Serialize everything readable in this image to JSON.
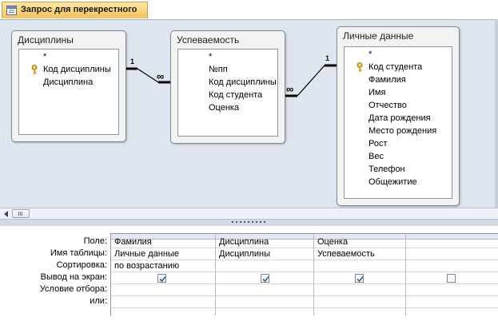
{
  "tab": {
    "title": "Запрос для перекрестного",
    "icon": "query-icon"
  },
  "tables": [
    {
      "id": "discipliny",
      "title": "Дисциплины",
      "fields": [
        {
          "name": "*",
          "key": false
        },
        {
          "name": "Код дисциплины",
          "key": true
        },
        {
          "name": "Дисциплина",
          "key": false
        }
      ]
    },
    {
      "id": "uspevaemost",
      "title": "Успеваемость",
      "fields": [
        {
          "name": "*",
          "key": false
        },
        {
          "name": "№пп",
          "key": false
        },
        {
          "name": "Код дисциплины",
          "key": false
        },
        {
          "name": "Код студента",
          "key": false
        },
        {
          "name": "Оценка",
          "key": false
        }
      ]
    },
    {
      "id": "lichnye",
      "title": "Личные данные",
      "fields": [
        {
          "name": "*",
          "key": false
        },
        {
          "name": "Код студента",
          "key": true
        },
        {
          "name": "Фамилия",
          "key": false
        },
        {
          "name": "Имя",
          "key": false
        },
        {
          "name": "Отчество",
          "key": false
        },
        {
          "name": "Дата рождения",
          "key": false
        },
        {
          "name": "Место рождения",
          "key": false
        },
        {
          "name": "Рост",
          "key": false
        },
        {
          "name": "Вес",
          "key": false
        },
        {
          "name": "Телефон",
          "key": false
        },
        {
          "name": "Общежитие",
          "key": false
        }
      ]
    }
  ],
  "relationships": [
    {
      "one": "1",
      "many": "∞"
    },
    {
      "one": "1",
      "many": "∞"
    }
  ],
  "grid": {
    "row_labels": [
      "Поле:",
      "Имя таблицы:",
      "Сортировка:",
      "Вывод на экран:",
      "Условие отбора:",
      "или:"
    ],
    "columns": [
      {
        "field": "Фамилия",
        "table": "Личные данные",
        "sort": "по возрастанию",
        "show": true
      },
      {
        "field": "Дисциплина",
        "table": "Дисциплины",
        "sort": "",
        "show": true
      },
      {
        "field": "Оценка",
        "table": "Успеваемость",
        "sort": "",
        "show": true
      },
      {
        "field": "",
        "table": "",
        "sort": "",
        "show": false
      }
    ]
  },
  "colors": {
    "tab": "#f3c35a",
    "pane": "#dfe5ee",
    "check": "#2f5fa8"
  }
}
